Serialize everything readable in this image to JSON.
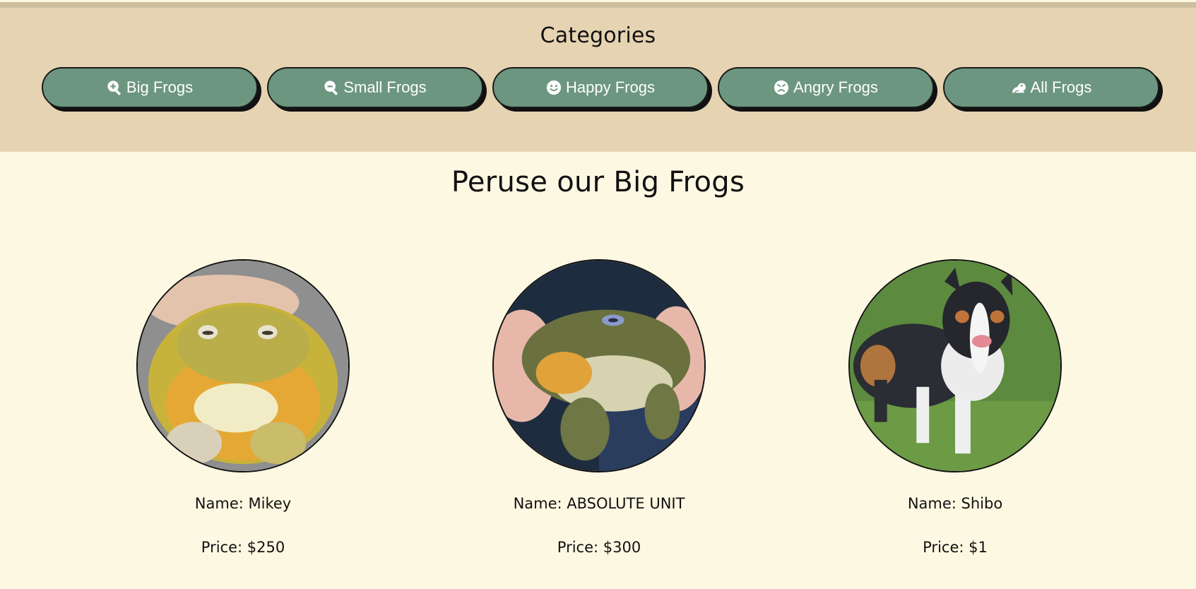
{
  "categories": {
    "title": "Categories",
    "buttons": [
      {
        "label": "Big Frogs",
        "icon": "zoom-in-icon"
      },
      {
        "label": "Small Frogs",
        "icon": "zoom-out-icon"
      },
      {
        "label": "Happy Frogs",
        "icon": "smile-icon"
      },
      {
        "label": "Angry Frogs",
        "icon": "angry-face-icon"
      },
      {
        "label": "All Frogs",
        "icon": "frog-icon"
      }
    ]
  },
  "main": {
    "title": "Peruse our Big Frogs",
    "items": [
      {
        "name": "Name: Mikey",
        "price": "Price: $250",
        "photo": "frog-photo"
      },
      {
        "name": "Name: ABSOLUTE UNIT",
        "price": "Price: $300",
        "photo": "frog-photo"
      },
      {
        "name": "Name: Shibo",
        "price": "Price: $1",
        "photo": "dog-photo"
      }
    ]
  },
  "colors": {
    "page_bg": "#fdf8e2",
    "header_bg": "#e6d3b2",
    "button_bg": "#6c9680",
    "button_text": "#ffffff"
  }
}
